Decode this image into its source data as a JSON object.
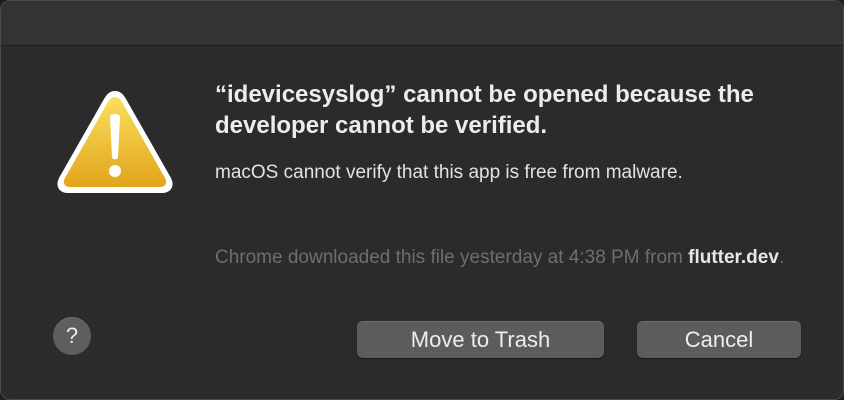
{
  "dialog": {
    "icon": "warning-triangle-icon",
    "headline": "“idevicesyslog” cannot be opened because the developer cannot be verified.",
    "message": "macOS cannot verify that this app is free from malware.",
    "source_prefix": "Chrome downloaded this file yesterday at 4:38 PM from ",
    "source_domain": "flutter.dev",
    "source_suffix": ".",
    "help_label": "?",
    "buttons": {
      "trash": "Move to Trash",
      "cancel": "Cancel"
    }
  },
  "colors": {
    "dialog_background": "#2b2b2b",
    "button_background": "#5c5c5c",
    "warning_yellow": "#f2c12e"
  }
}
